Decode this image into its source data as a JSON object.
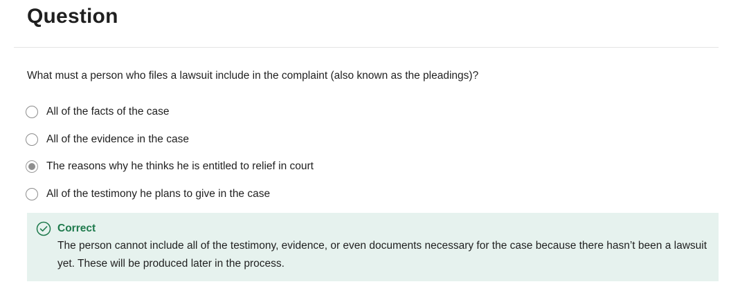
{
  "question": {
    "heading": "Question",
    "prompt": "What must a person who files a lawsuit include in the complaint (also known as the pleadings)?",
    "options": [
      {
        "label": "All of the facts of the case",
        "selected": false
      },
      {
        "label": "All of the evidence in the case",
        "selected": false
      },
      {
        "label": "The reasons why he thinks he is entitled to relief in court",
        "selected": true
      },
      {
        "label": "All of the testimony he plans to give in the case",
        "selected": false
      }
    ]
  },
  "feedback": {
    "status": "Correct",
    "icon": "check-circle-icon",
    "status_color": "#1e7a4c",
    "background_color": "#e6f2ee",
    "explanation": "The person cannot include all of the testimony, evidence, or even documents necessary for the case because there hasn’t been a lawsuit yet. These will be produced later in the process."
  }
}
